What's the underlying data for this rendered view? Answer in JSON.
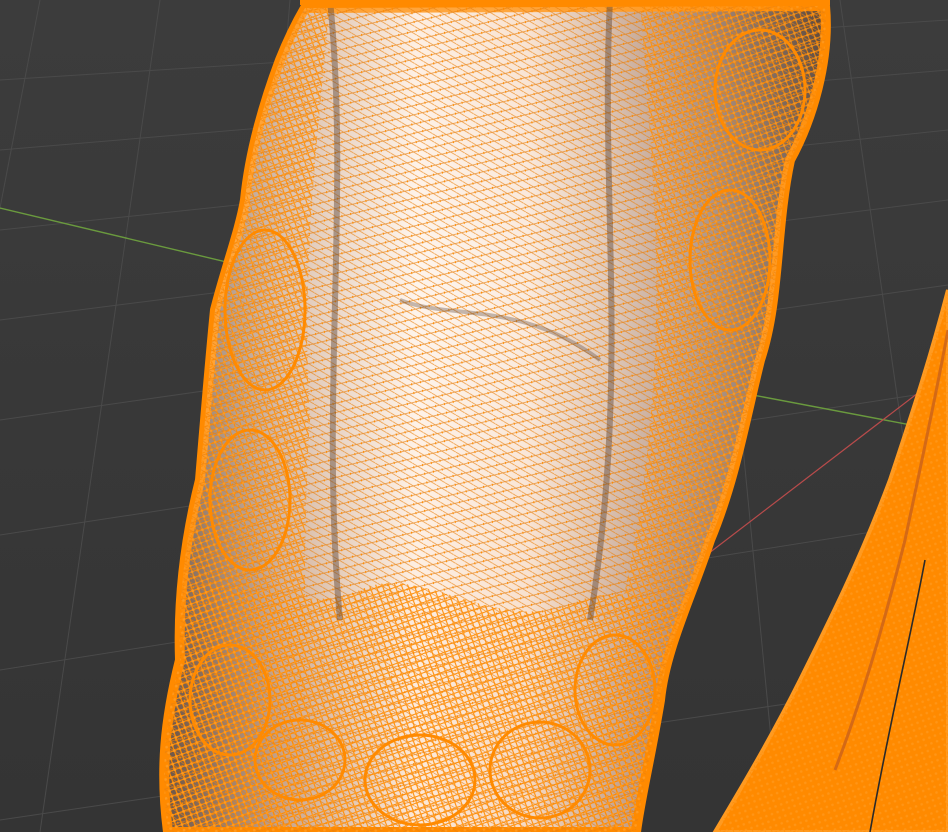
{
  "viewport": {
    "mode": "edit-mode",
    "background_color": "#393939",
    "grid_color": "#4a4a4a",
    "x_axis_color": "#b84b4b",
    "y_axis_color": "#6a9a3e",
    "selection_color": "#ff8a00",
    "surface_light": "#fde4cf",
    "surface_dark": "#4a3a30"
  }
}
